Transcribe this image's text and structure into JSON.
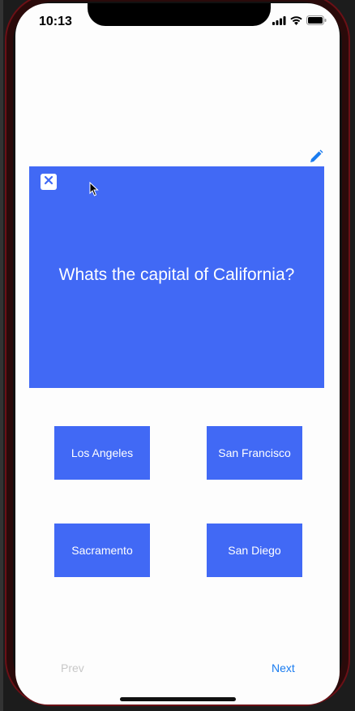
{
  "status_bar": {
    "time": "10:13"
  },
  "card": {
    "question": "Whats the capital of California?",
    "close_icon": "close-icon",
    "edit_icon": "pencil-icon",
    "color": "#4169f5"
  },
  "answers": [
    {
      "label": "Los Angeles"
    },
    {
      "label": "San Francisco"
    },
    {
      "label": "Sacramento"
    },
    {
      "label": "San Diego"
    }
  ],
  "nav": {
    "prev_label": "Prev",
    "next_label": "Next",
    "prev_color": "#c8c8c8",
    "next_color": "#1a7cf0"
  }
}
